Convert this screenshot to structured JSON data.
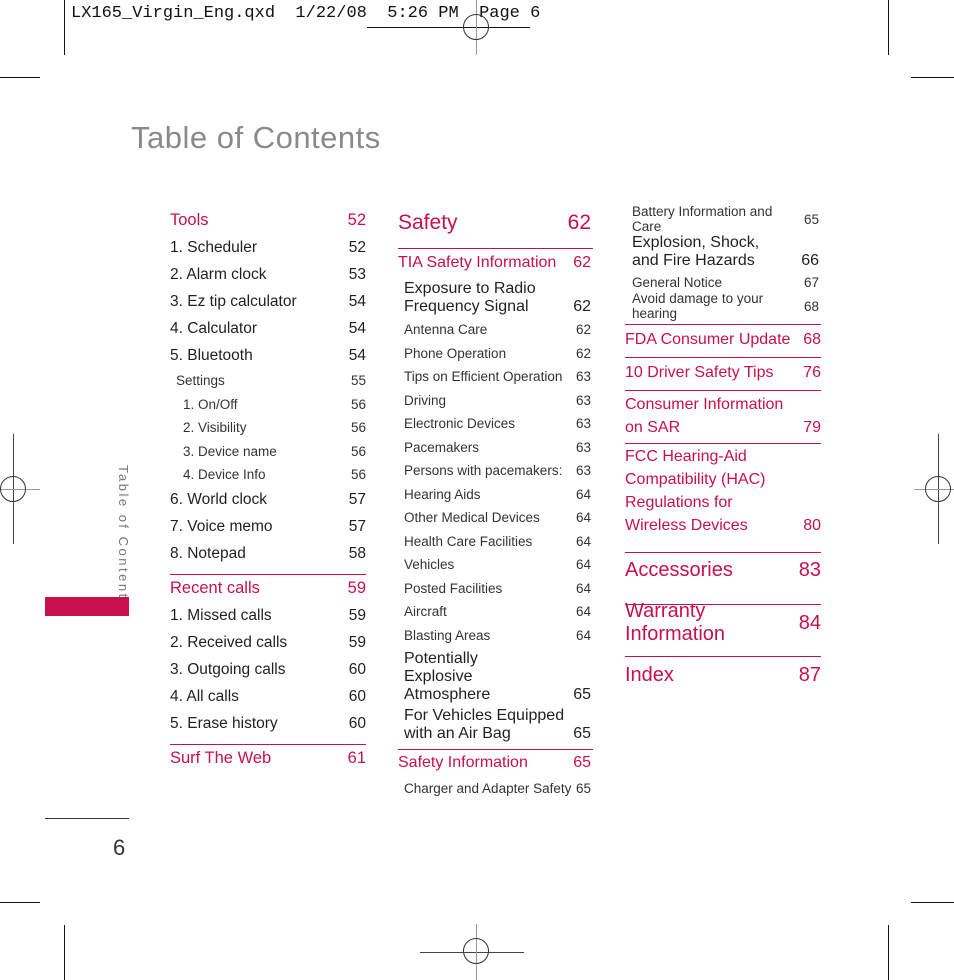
{
  "slug": "LX165_Virgin_Eng.qxd  1/22/08  5:26 PM  Page 6",
  "page_title": "Table of Contents",
  "side_label": "Table of Contents",
  "page_number": "6",
  "colors": {
    "accent": "#c8104a",
    "title_gray": "#8a8a8a",
    "text": "#231f20"
  },
  "col1": {
    "sections": [
      {
        "label": "Tools",
        "page": "52",
        "items": [
          {
            "label": "1. Scheduler",
            "page": "52"
          },
          {
            "label": "2. Alarm clock",
            "page": "53"
          },
          {
            "label": "3. Ez tip calculator",
            "page": "54"
          },
          {
            "label": "4. Calculator",
            "page": "54"
          },
          {
            "label": "5. Bluetooth",
            "page": "54"
          }
        ],
        "sub": {
          "label": "Settings",
          "page": "55",
          "items": [
            {
              "label": "1. On/Off",
              "page": "56"
            },
            {
              "label": "2. Visibility",
              "page": "56"
            },
            {
              "label": "3. Device name",
              "page": "56"
            },
            {
              "label": "4. Device Info",
              "page": "56"
            }
          ]
        },
        "items_after": [
          {
            "label": "6. World clock",
            "page": "57"
          },
          {
            "label": "7. Voice memo",
            "page": "57"
          },
          {
            "label": "8. Notepad",
            "page": "58"
          }
        ]
      },
      {
        "label": "Recent calls",
        "page": "59",
        "items": [
          {
            "label": "1. Missed calls",
            "page": "59"
          },
          {
            "label": "2. Received calls",
            "page": "59"
          },
          {
            "label": "3. Outgoing calls",
            "page": "60"
          },
          {
            "label": "4. All calls",
            "page": "60"
          },
          {
            "label": "5. Erase history",
            "page": "60"
          }
        ]
      },
      {
        "label": "Surf The Web",
        "page": "61"
      }
    ]
  },
  "col2": {
    "chapter": {
      "label": "Safety",
      "page": "62"
    },
    "tia": {
      "label": "TIA Safety Information",
      "page": "62",
      "items": [
        {
          "label": "Exposure to Radio Frequency Signal",
          "page": "62"
        },
        {
          "label": "Antenna Care",
          "page": "62"
        },
        {
          "label": "Phone Operation",
          "page": "62"
        },
        {
          "label": "Tips on Efficient Operation",
          "page": "63"
        },
        {
          "label": "Driving",
          "page": "63"
        },
        {
          "label": "Electronic Devices",
          "page": "63"
        },
        {
          "label": "Pacemakers",
          "page": "63"
        },
        {
          "label": "Persons with pacemakers:",
          "page": "63"
        },
        {
          "label": "Hearing Aids",
          "page": "64"
        },
        {
          "label": "Other Medical Devices",
          "page": "64"
        },
        {
          "label": "Health Care Facilities",
          "page": "64"
        },
        {
          "label": "Vehicles",
          "page": "64"
        },
        {
          "label": "Posted Facilities",
          "page": "64"
        },
        {
          "label": "Aircraft",
          "page": "64"
        },
        {
          "label": "Blasting Areas",
          "page": "64"
        },
        {
          "label": "Potentially Explosive Atmosphere",
          "page": "65"
        },
        {
          "label": "For Vehicles Equipped with an Air Bag",
          "page": "65"
        }
      ]
    },
    "safety_info": {
      "label": "Safety Information",
      "page": "65",
      "items": [
        {
          "label": "Charger and Adapter Safety",
          "page": "65"
        }
      ]
    }
  },
  "col3": {
    "items": [
      {
        "label": "Battery Information and Care",
        "page": "65"
      },
      {
        "label": "Explosion, Shock, and Fire Hazards",
        "page": "66"
      },
      {
        "label": "General Notice",
        "page": "67"
      },
      {
        "label": "Avoid damage to your hearing",
        "page": "68"
      }
    ],
    "sections": [
      {
        "label": "FDA Consumer Update",
        "page": "68"
      },
      {
        "label": "10 Driver Safety Tips",
        "page": "76"
      },
      {
        "label": "Consumer Information on SAR",
        "page": "79"
      },
      {
        "label": "FCC Hearing-Aid Compatibility (HAC) Regulations for Wireless Devices",
        "page": "80"
      }
    ],
    "chapters": [
      {
        "label": "Accessories",
        "page": "83"
      },
      {
        "label": "Warranty Information",
        "page": "84"
      },
      {
        "label": "Index",
        "page": "87"
      }
    ]
  }
}
